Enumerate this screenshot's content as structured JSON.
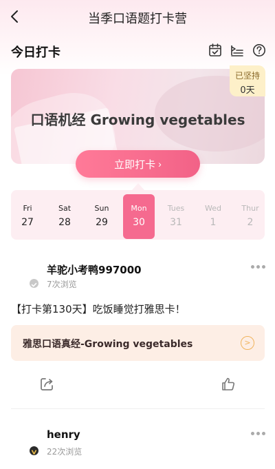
{
  "nav": {
    "title": "当季口语题打卡营",
    "back_icon": "chevron-left-icon"
  },
  "section": {
    "title": "今日打卡",
    "icons": [
      "calendar-check-icon",
      "list-icon",
      "help-circle-icon"
    ]
  },
  "banner": {
    "title": "口语机经 Growing vegetables",
    "streak_label": "已坚持",
    "streak_value": "0天",
    "checkin_label": "立即打卡",
    "checkin_arrow": "›"
  },
  "dates": [
    {
      "name": "Fri",
      "date": "27",
      "state": "past"
    },
    {
      "name": "Sat",
      "date": "28",
      "state": "past"
    },
    {
      "name": "Sun",
      "date": "29",
      "state": "past"
    },
    {
      "name": "Mon",
      "date": "30",
      "state": "active"
    },
    {
      "name": "Tues",
      "date": "31",
      "state": "future"
    },
    {
      "name": "Wed",
      "date": "1",
      "state": "future"
    },
    {
      "name": "Thur",
      "date": "2",
      "state": "future"
    }
  ],
  "posts": [
    {
      "username": "羊驼小考鸭997000",
      "views": "7次浏览",
      "text": "【打卡第130天】吃饭睡觉打雅思卡！",
      "topic": "雅思口语真经-Growing vegetables",
      "badge_color": "#c8c8c8"
    },
    {
      "username": "henry",
      "views": "22次浏览",
      "badge_color": "#2b2b2b"
    }
  ],
  "colors": {
    "accent": "#f26287",
    "streak_bg": "#fdf0c9",
    "date_strip_bg": "#fdeef2",
    "topic_bg": "#fdeee5"
  }
}
